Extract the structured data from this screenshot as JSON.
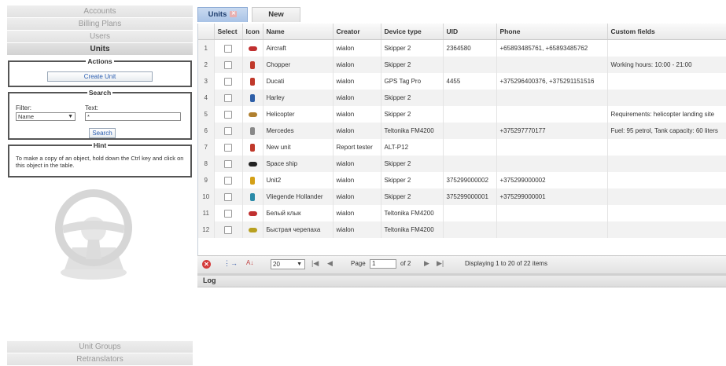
{
  "sidebar": {
    "top_items": [
      {
        "label": "Accounts"
      },
      {
        "label": "Billing Plans"
      },
      {
        "label": "Users"
      },
      {
        "label": "Units"
      }
    ],
    "actions": {
      "title": "Actions",
      "create_label": "Create Unit"
    },
    "search": {
      "title": "Search",
      "filter_label": "Filter:",
      "text_label": "Text:",
      "filter_value": "Name",
      "text_value": "*",
      "button_label": "Search"
    },
    "hint": {
      "title": "Hint",
      "text": "To make a copy of an object, hold down the Ctrl key and click on this object in the table."
    },
    "bottom_items": [
      {
        "label": "Unit Groups"
      },
      {
        "label": "Retranslators"
      }
    ]
  },
  "tabs": [
    {
      "label": "Units",
      "active": true
    },
    {
      "label": "New",
      "active": false
    }
  ],
  "grid": {
    "columns": [
      "",
      "Select",
      "Icon",
      "Name",
      "Creator",
      "Device type",
      "UID",
      "Phone",
      "Custom fields"
    ],
    "rows": [
      {
        "num": "1",
        "icon": "plane-icon",
        "icon_color": "#c03030",
        "name": "Aircraft",
        "creator": "wialon",
        "device": "Skipper 2",
        "uid": "2364580",
        "phone": "+65893485761, +65893485762",
        "custom": ""
      },
      {
        "num": "2",
        "icon": "car-icon",
        "icon_color": "#c0392b",
        "name": "Chopper",
        "creator": "wialon",
        "device": "Skipper 2",
        "uid": "",
        "phone": "",
        "custom": "Working hours: 10:00 - 21:00"
      },
      {
        "num": "3",
        "icon": "car-icon",
        "icon_color": "#c0392b",
        "name": "Ducati",
        "creator": "wialon",
        "device": "GPS Tag Pro",
        "uid": "4455",
        "phone": "+375296400376, +375291151516",
        "custom": ""
      },
      {
        "num": "4",
        "icon": "car-icon",
        "icon_color": "#2e5fa8",
        "name": "Harley",
        "creator": "wialon",
        "device": "Skipper 2",
        "uid": "",
        "phone": "",
        "custom": ""
      },
      {
        "num": "5",
        "icon": "helicopter-icon",
        "icon_color": "#b08030",
        "name": "Helicopter",
        "creator": "wialon",
        "device": "Skipper 2",
        "uid": "",
        "phone": "",
        "custom": "Requirements: helicopter landing site"
      },
      {
        "num": "6",
        "icon": "car-icon",
        "icon_color": "#888888",
        "name": "Mercedes",
        "creator": "wialon",
        "device": "Teltonika FM4200",
        "uid": "",
        "phone": "+375297770177",
        "custom": "Fuel: 95 petrol, Tank capacity: 60 liters"
      },
      {
        "num": "7",
        "icon": "car-icon",
        "icon_color": "#c0392b",
        "name": "New unit",
        "creator": "Report tester",
        "device": "ALT-P12",
        "uid": "",
        "phone": "",
        "custom": ""
      },
      {
        "num": "8",
        "icon": "ship-icon",
        "icon_color": "#222222",
        "name": "Space ship",
        "creator": "wialon",
        "device": "Skipper 2",
        "uid": "",
        "phone": "",
        "custom": ""
      },
      {
        "num": "9",
        "icon": "car-icon",
        "icon_color": "#d4a017",
        "name": "Unit2",
        "creator": "wialon",
        "device": "Skipper 2",
        "uid": "375299000002",
        "phone": "+375299000002",
        "custom": ""
      },
      {
        "num": "10",
        "icon": "car-icon",
        "icon_color": "#2a8aa8",
        "name": "Vliegende Hollander",
        "creator": "wialon",
        "device": "Skipper 2",
        "uid": "375299000001",
        "phone": "+375299000001",
        "custom": ""
      },
      {
        "num": "11",
        "icon": "truck-icon",
        "icon_color": "#c03030",
        "name": "Белый клык",
        "creator": "wialon",
        "device": "Teltonika FM4200",
        "uid": "",
        "phone": "",
        "custom": ""
      },
      {
        "num": "12",
        "icon": "truck-icon",
        "icon_color": "#b8a020",
        "name": "Быстрая черепаха",
        "creator": "wialon",
        "device": "Teltonika FM4200",
        "uid": "",
        "phone": "",
        "custom": ""
      }
    ]
  },
  "pager": {
    "page_size": "20",
    "page_label": "Page",
    "page_value": "1",
    "of_label": "of 2",
    "status": "Displaying 1 to 20 of 22 items"
  },
  "log": {
    "label": "Log"
  },
  "colors": {
    "accent": "#2a5db0",
    "tab_active": "#b4cceb",
    "danger": "#d43a3a"
  }
}
